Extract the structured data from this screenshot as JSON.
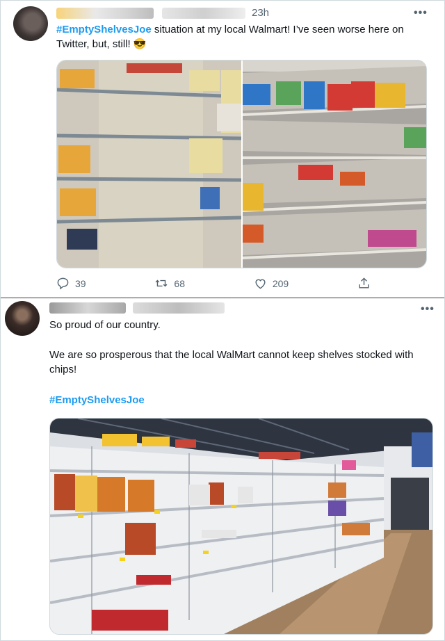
{
  "tweet1": {
    "time": "23h",
    "more": "•••",
    "hashtag": "#EmptyShelvesJoe",
    "text_after": " situation at my local Walmart! I’ve seen worse here on Twitter, but, still! 😎",
    "replies": "39",
    "retweets": "68",
    "likes": "209"
  },
  "tweet2": {
    "more": "•••",
    "line1": "So proud of our country.",
    "line2": "We are so prosperous that the local WalMart cannot keep shelves stocked with chips!",
    "hashtag": "#EmptyShelvesJoe"
  },
  "colors": {
    "link": "#1d9bf0",
    "muted": "#536471",
    "border": "#cfd9de"
  },
  "icons": [
    "reply-icon",
    "retweet-icon",
    "like-icon",
    "share-icon",
    "more-icon"
  ]
}
